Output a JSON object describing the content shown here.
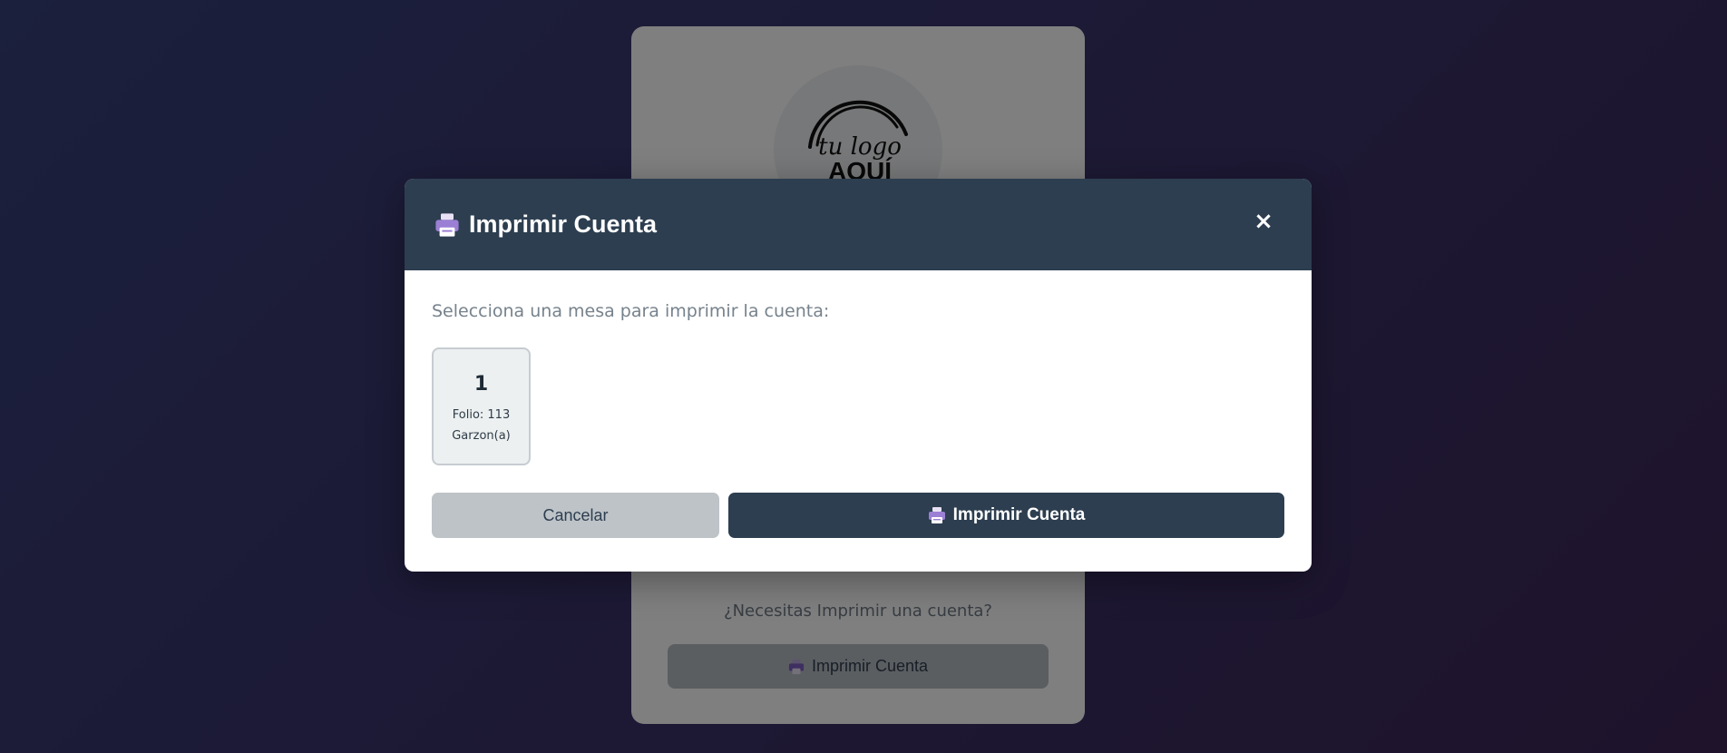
{
  "background": {
    "logo_text_line1": "tu logo",
    "logo_text_line2": "AQUÍ",
    "question": "¿Necesitas Imprimir una cuenta?",
    "print_button_label": "Imprimir Cuenta",
    "print_icon": "printer-icon"
  },
  "modal": {
    "title": "Imprimir Cuenta",
    "title_icon": "printer-icon",
    "close_label": "×",
    "subtitle": "Selecciona una mesa para imprimir la cuenta:",
    "tables": [
      {
        "number": "1",
        "folio": "Folio: 113",
        "waiter": "Garzon(a)"
      }
    ],
    "cancel_label": "Cancelar",
    "print_label": "Imprimir Cuenta",
    "print_icon": "printer-icon"
  },
  "colors": {
    "header": "#2d3e50",
    "primary_button": "#2d3e50",
    "cancel_button": "#bdc3c7",
    "icon_accent": "#9b7fd4"
  }
}
